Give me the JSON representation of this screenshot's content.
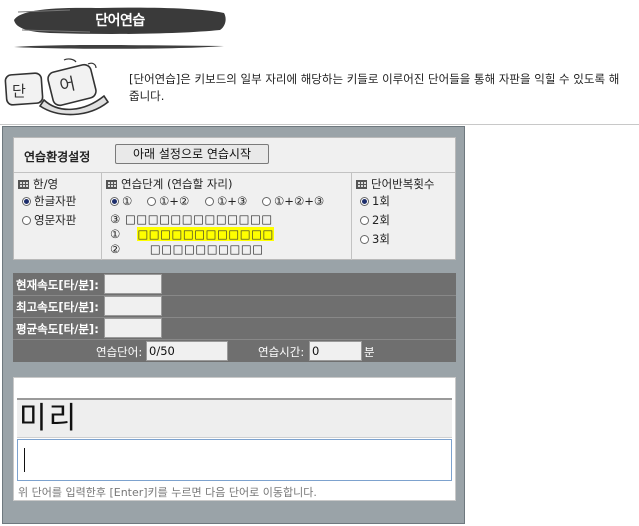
{
  "header": {
    "title": "단어연습",
    "description": "[단어연습]은 키보드의 일부 자리에 해당하는 키들로 이루어진 단어들을 통해 자판을 익힐 수 있도록 해 줍니다."
  },
  "settings": {
    "title": "연습환경설정",
    "start_button": "아래 설정으로 연습시작",
    "language": {
      "heading": "한/영",
      "options": [
        "한글자판",
        "영문자판"
      ],
      "selected": 0
    },
    "stage": {
      "heading": "연습단계 (연습할 자리)",
      "options": [
        "①",
        "①+②",
        "①+③",
        "①+②+③"
      ],
      "selected": 0,
      "rows": [
        {
          "marker": "③",
          "keys": "□□□□□□□□□□□□□"
        },
        {
          "marker": "①",
          "keys": "□□□□□□□□□□□□"
        },
        {
          "marker": "②",
          "keys": "□□□□□□□□□□"
        }
      ]
    },
    "repeat": {
      "heading": "단어반복횟수",
      "options": [
        "1회",
        "2회",
        "3회"
      ],
      "selected": 0
    }
  },
  "stats": {
    "current_speed_label": "현재속도[타/분]:",
    "max_speed_label": "최고속도[타/분]:",
    "avg_speed_label": "평균속도[타/분]:",
    "current_speed_value": "",
    "max_speed_value": "",
    "avg_speed_value": "",
    "word_count_label": "연습단어:",
    "word_count_value": "0/50",
    "time_label": "연습시간:",
    "time_value": "0",
    "time_unit": "분"
  },
  "practice": {
    "current_word": "미리",
    "input_value": "",
    "hint": "위 단어를 입력한후 [Enter]키를 누르면 다음 단어로 이동합니다."
  }
}
